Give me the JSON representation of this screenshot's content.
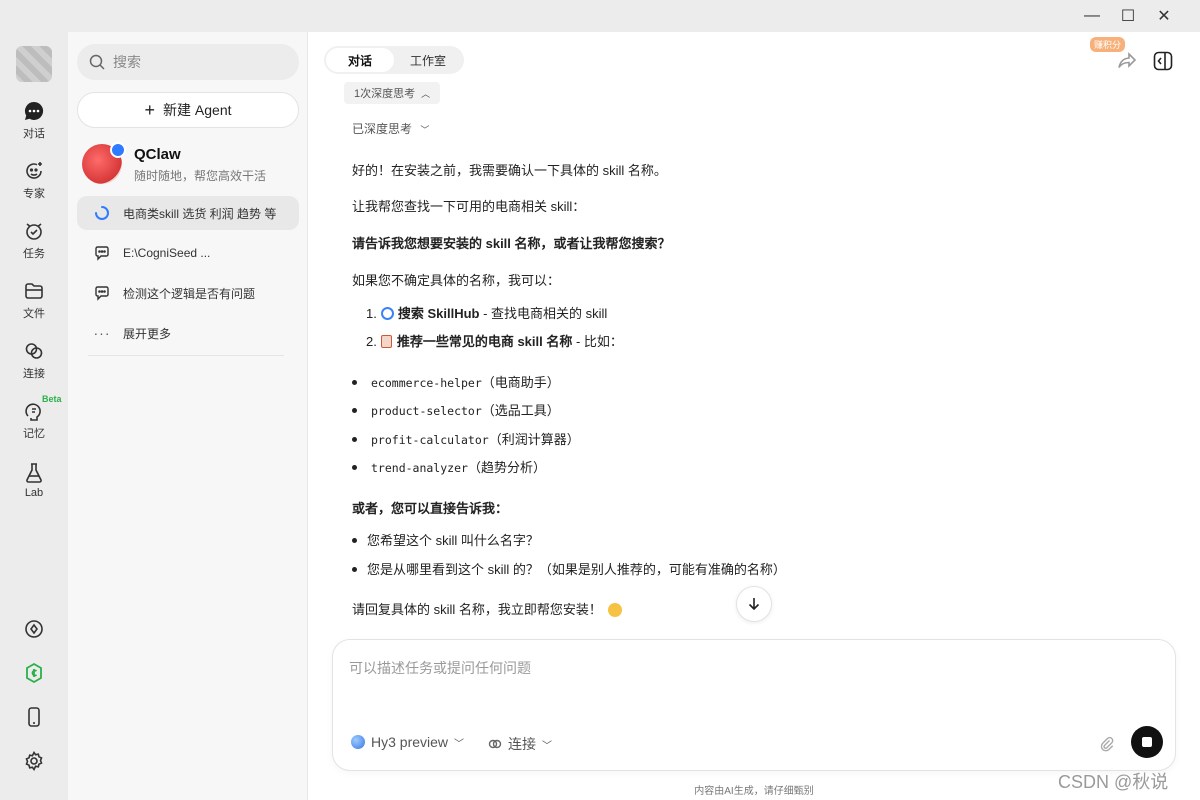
{
  "window": {
    "minimize": "—",
    "maximize": "☐",
    "close": "✕"
  },
  "rail": {
    "items": [
      {
        "label": "对话",
        "icon": "chat-bubble-icon"
      },
      {
        "label": "专家",
        "icon": "expert-face-icon"
      },
      {
        "label": "任务",
        "icon": "task-clock-icon"
      },
      {
        "label": "文件",
        "icon": "folder-icon"
      },
      {
        "label": "连接",
        "icon": "link-icon"
      },
      {
        "label": "记忆",
        "icon": "memory-icon",
        "badge": "Beta"
      },
      {
        "label": "Lab",
        "icon": "flask-icon"
      }
    ],
    "accent_green": "#2bb04a"
  },
  "sidebar": {
    "search_placeholder": "搜索",
    "new_agent": "新建 Agent",
    "agent": {
      "name": "QClaw",
      "subtitle": "随时随地，帮您高效干活"
    },
    "chats": [
      {
        "title": "电商类skill 选货 利润 趋势 等",
        "state": "loading"
      },
      {
        "title": "E:\\CogniSeed ...",
        "state": "idle"
      },
      {
        "title": "检测这个逻辑是否有问题",
        "state": "idle"
      }
    ],
    "expand_more": "展开更多"
  },
  "header": {
    "tabs": [
      {
        "label": "对话",
        "active": true
      },
      {
        "label": "工作室",
        "active": false
      }
    ],
    "earn_badge": "赚积分"
  },
  "conversation": {
    "think_count": "1次深度思考",
    "think_done": "已深度思考",
    "p1": "好的！在安装之前，我需要确认一下具体的 skill 名称。",
    "p2": "让我帮您查找一下可用的电商相关 skill：",
    "p3": "请告诉我您想要安装的 skill 名称，或者让我帮您搜索？",
    "p4": "如果您不确定具体的名称，我可以：",
    "ol": [
      {
        "num": "1.",
        "bold": "搜索 SkillHub",
        "rest": " - 查找电商相关的 skill"
      },
      {
        "num": "2.",
        "bold": "推荐一些常见的电商 skill 名称",
        "rest": " - 比如："
      }
    ],
    "skills": [
      {
        "code": "ecommerce-helper",
        "desc": "（电商助手）"
      },
      {
        "code": "product-selector",
        "desc": "（选品工具）"
      },
      {
        "code": "profit-calculator",
        "desc": "（利润计算器）"
      },
      {
        "code": "trend-analyzer",
        "desc": "（趋势分析）"
      }
    ],
    "p5": "或者，您可以直接告诉我：",
    "questions": [
      "您希望这个 skill 叫什么名字？",
      "您是从哪里看到这个 skill 的？（如果是别人推荐的，可能有准确的名称）"
    ],
    "p6": "请回复具体的 skill 名称，我立即帮您安装！"
  },
  "composer": {
    "placeholder": "可以描述任务或提问任何问题",
    "model": "Hy3 preview",
    "connect": "连接"
  },
  "footer": {
    "disclaimer": "内容由AI生成，请仔细甄别",
    "watermark": "CSDN @秋说"
  }
}
